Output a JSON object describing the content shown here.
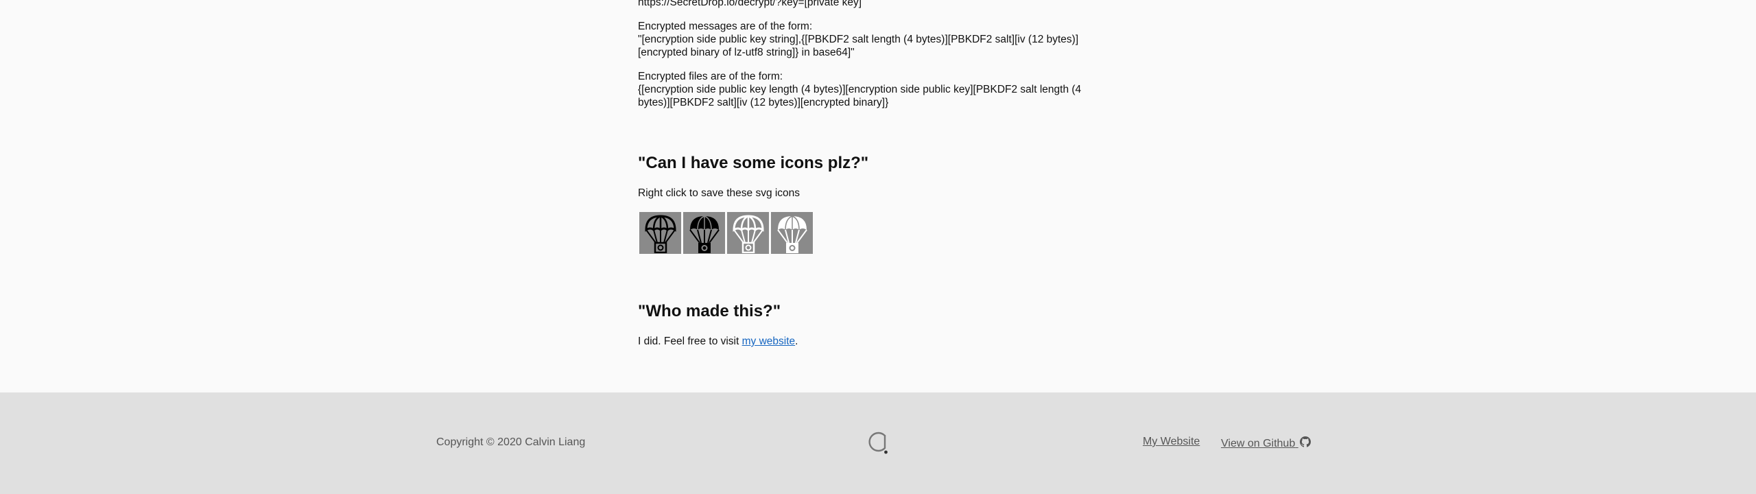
{
  "top_url_line": "https://SecretDrop.io/decrypt/?key=[private key]",
  "messages": {
    "intro": "Encrypted messages are of the form:",
    "line1": "\"[encryption side public key string],{[PBKDF2 salt length (4 bytes)][PBKDF2 salt][iv (12 bytes)]",
    "line2": "[encrypted binary of lz-utf8 string]} in base64]\""
  },
  "files": {
    "intro": "Encrypted files are of the form:",
    "line1": "{[encryption side public key length (4 bytes)][encryption side public key][PBKDF2 salt length (4",
    "line2": "bytes)][PBKDF2 salt][iv (12 bytes)][encrypted binary]}"
  },
  "icons_section": {
    "heading": "\"Can I have some icons plz?\"",
    "text": "Right click to save these svg icons",
    "icons": [
      {
        "name": "parachute-outline-dark-icon"
      },
      {
        "name": "parachute-filled-dark-icon"
      },
      {
        "name": "parachute-outline-light-icon"
      },
      {
        "name": "parachute-filled-light-icon"
      }
    ]
  },
  "about_section": {
    "heading": "\"Who made this?\"",
    "text_before": "I did. Feel free to visit ",
    "link_text": "my website",
    "text_after": "."
  },
  "footer": {
    "copyright": "Copyright © 2020 Calvin Liang",
    "my_website": "My Website",
    "view_github": "View on Github",
    "logo_icon": "loading-logo-icon",
    "github_icon": "github-icon",
    "background": "#e0e0e0"
  }
}
